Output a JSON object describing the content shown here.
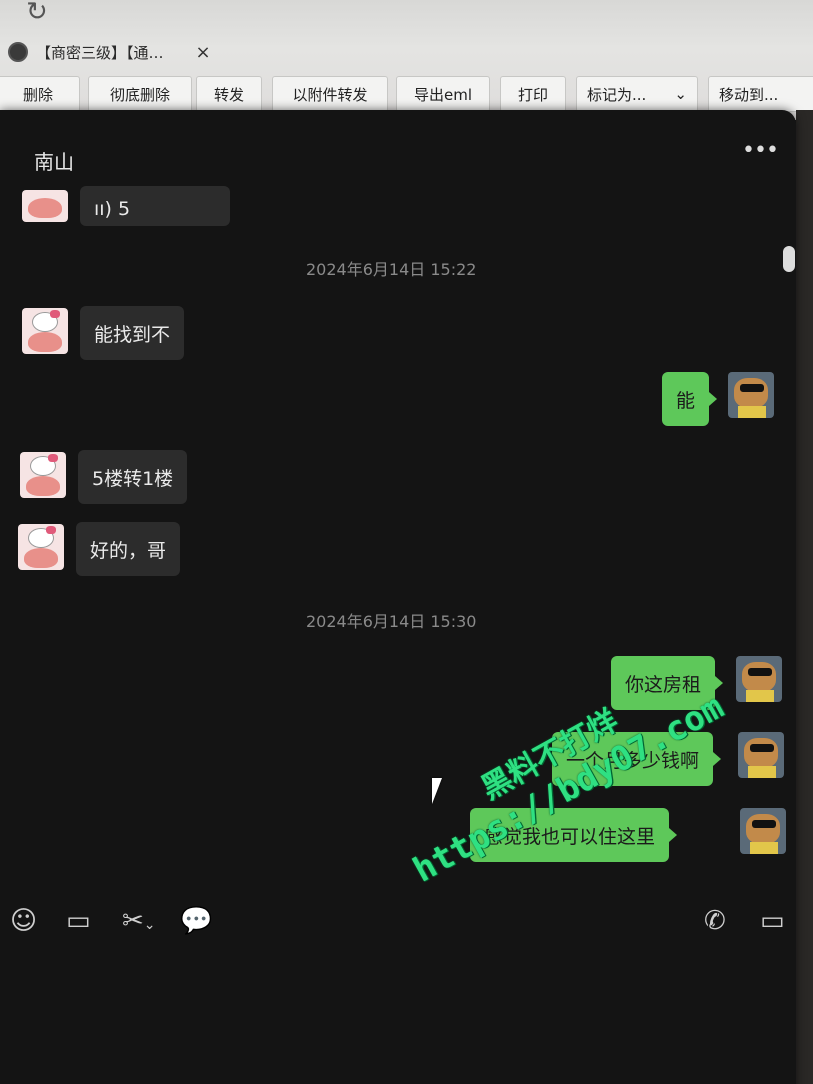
{
  "browser": {
    "tab_title": "【商密三级】【通…",
    "tab_close": "×",
    "reload_icon": "reload-icon"
  },
  "toolbar": {
    "buttons": [
      "删除",
      "彻底删除",
      "转发",
      "以附件转发",
      "导出eml",
      "打印",
      "标记为...",
      "移动到..."
    ],
    "dropdown_arrow": "⌄"
  },
  "chat": {
    "title": "南山",
    "more_icon": "•••",
    "partial_message": "ıı) 5",
    "sections": [
      {
        "timestamp": "2024年6月14日 15:22",
        "messages": [
          {
            "side": "in",
            "text": "能找到不"
          },
          {
            "side": "out",
            "text": "能"
          },
          {
            "side": "in",
            "text": "5楼转1楼"
          },
          {
            "side": "in",
            "text": "好的，哥"
          }
        ]
      },
      {
        "timestamp": "2024年6月14日 15:30",
        "messages": [
          {
            "side": "out",
            "text": "你这房租"
          },
          {
            "side": "out",
            "text": "一个月多少钱啊"
          },
          {
            "side": "out",
            "text": "感觉我也可以住这里"
          }
        ]
      }
    ]
  },
  "input_bar": {
    "icons": [
      "emoji-icon",
      "folder-icon",
      "scissors-icon",
      "chat-bubble-icon",
      "phone-icon",
      "video-icon"
    ]
  },
  "watermark": {
    "line1": "黑料不打烊",
    "line2": "https://bdy07.com"
  },
  "colors": {
    "bubble_out": "#5ec85a",
    "bubble_in": "#2c2c2c",
    "window_bg": "#141414",
    "watermark": "#2fe082"
  }
}
